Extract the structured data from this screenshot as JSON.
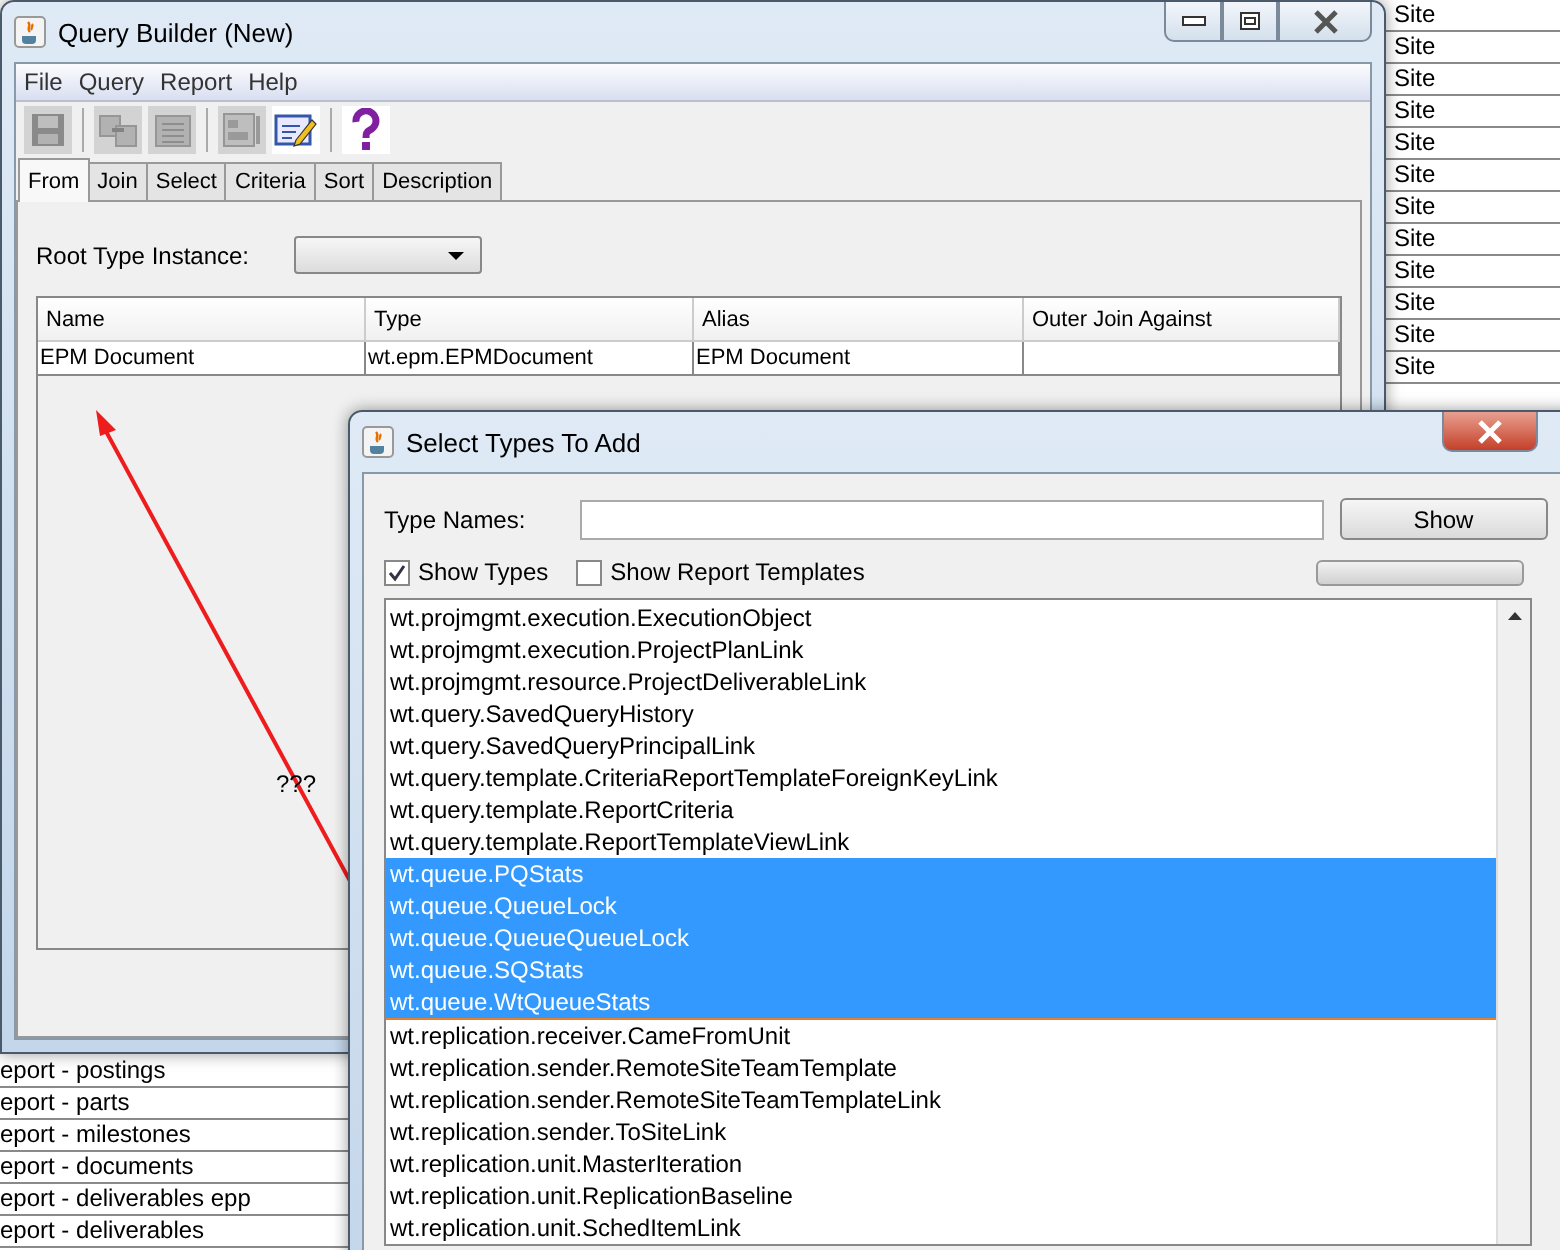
{
  "main_window": {
    "title": "Query Builder (New)",
    "menu": [
      "File",
      "Query",
      "Report",
      "Help"
    ],
    "toolbar": [
      {
        "kind": "save",
        "disabled": true
      },
      {
        "kind": "join",
        "disabled": true
      },
      {
        "kind": "select",
        "disabled": true
      },
      {
        "kind": "form",
        "disabled": true
      },
      {
        "kind": "edit",
        "disabled": false
      },
      {
        "kind": "help",
        "disabled": false
      }
    ],
    "tabs": [
      {
        "label": "From",
        "selected": true
      },
      {
        "label": "Join",
        "selected": false
      },
      {
        "label": "Select",
        "selected": false
      },
      {
        "label": "Criteria",
        "selected": false
      },
      {
        "label": "Sort",
        "selected": false
      },
      {
        "label": "Description",
        "selected": false
      }
    ],
    "root_type_label": "Root Type Instance:",
    "table": {
      "columns": [
        "Name",
        "Type",
        "Alias",
        "Outer Join Against"
      ],
      "rows": [
        {
          "cells": [
            "EPM Document",
            "wt.epm.EPMDocument",
            "EPM Document"
          ]
        }
      ]
    }
  },
  "annotation": {
    "text": "???"
  },
  "dialog": {
    "title": "Select Types To Add",
    "type_names_label": "Type Names:",
    "show_button": "Show",
    "checkboxes": [
      {
        "label": "Show Types",
        "checked": true
      },
      {
        "label": "Show Report Templates",
        "checked": false
      }
    ],
    "progress": {
      "level": 0
    },
    "items": [
      {
        "label": "wt.projmgmt.execution.ExecutionObject",
        "selected": false
      },
      {
        "label": "wt.projmgmt.execution.ProjectPlanLink",
        "selected": false
      },
      {
        "label": "wt.projmgmt.resource.ProjectDeliverableLink",
        "selected": false
      },
      {
        "label": "wt.query.SavedQueryHistory",
        "selected": false
      },
      {
        "label": "wt.query.SavedQueryPrincipalLink",
        "selected": false
      },
      {
        "label": "wt.query.template.CriteriaReportTemplateForeignKeyLink",
        "selected": false
      },
      {
        "label": "wt.query.template.ReportCriteria",
        "selected": false
      },
      {
        "label": "wt.query.template.ReportTemplateViewLink",
        "selected": false
      },
      {
        "label": "wt.queue.PQStats",
        "selected": true
      },
      {
        "label": "wt.queue.QueueLock",
        "selected": true
      },
      {
        "label": "wt.queue.QueueQueueLock",
        "selected": true
      },
      {
        "label": "wt.queue.SQStats",
        "selected": true
      },
      {
        "label": "wt.queue.WtQueueStats",
        "selected": true
      },
      {
        "label": "wt.replication.receiver.CameFromUnit",
        "selected": false
      },
      {
        "label": "wt.replication.sender.RemoteSiteTeamTemplate",
        "selected": false
      },
      {
        "label": "wt.replication.sender.RemoteSiteTeamTemplateLink",
        "selected": false
      },
      {
        "label": "wt.replication.sender.ToSiteLink",
        "selected": false
      },
      {
        "label": "wt.replication.unit.MasterIteration",
        "selected": false
      },
      {
        "label": "wt.replication.unit.ReplicationBaseline",
        "selected": false
      },
      {
        "label": "wt.replication.unit.SchedItemLink",
        "selected": false
      }
    ]
  },
  "right_list": [
    "Site",
    "Site",
    "Site",
    "Site",
    "Site",
    "Site",
    "Site",
    "Site",
    "Site",
    "Site",
    "Site",
    "Site"
  ],
  "bottom_list": [
    "eport - postings",
    "eport - parts",
    "eport - milestones",
    "eport - documents",
    "eport - deliverables epp",
    "eport - deliverables"
  ]
}
